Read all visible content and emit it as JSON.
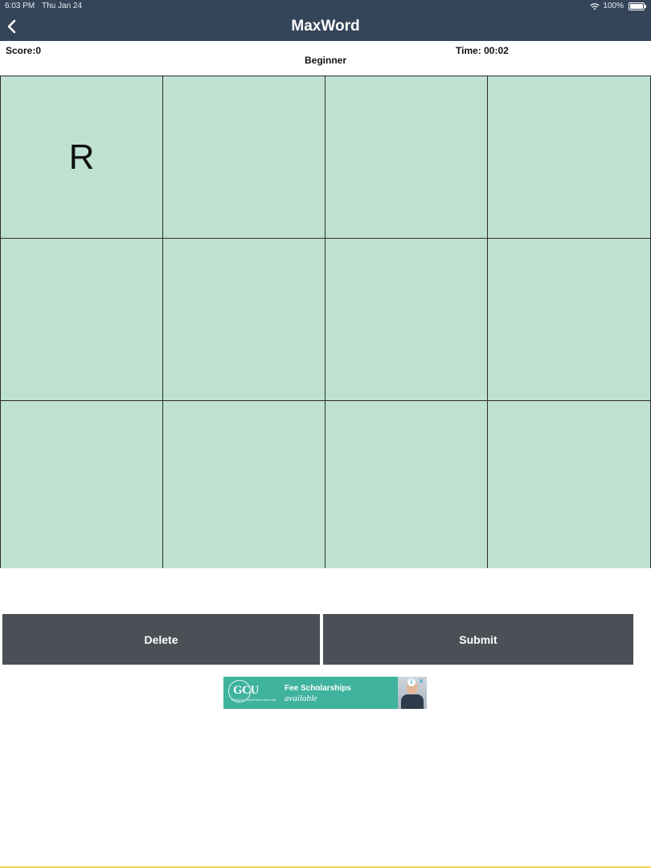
{
  "status_bar": {
    "time": "6:03 PM",
    "date": "Thu Jan 24",
    "battery": "100%"
  },
  "nav": {
    "title": "MaxWord"
  },
  "game": {
    "score_label": "Score:0",
    "level": "Beginner",
    "time_label": "Time: 00:02"
  },
  "board": {
    "rows": [
      [
        "R",
        "",
        "",
        ""
      ],
      [
        "",
        "",
        "",
        ""
      ],
      [
        "",
        "",
        "",
        ""
      ]
    ]
  },
  "buttons": {
    "delete": "Delete",
    "submit": "Submit"
  },
  "ad": {
    "logo": "GCU",
    "logo_sub": "Glasgow Caledonian University",
    "headline": "Fee Scholarships",
    "subline": "available"
  },
  "colors": {
    "nav_bg": "#354559",
    "board_bg": "#bfe1d2",
    "button_bg": "#4b5057",
    "ad_bg": "#3fb39e"
  }
}
